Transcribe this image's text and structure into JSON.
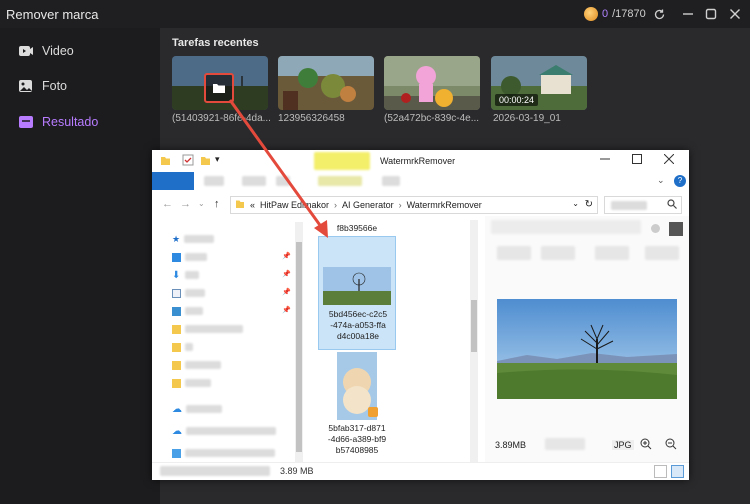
{
  "app": {
    "title": "Remover marca"
  },
  "credits": {
    "used": "0",
    "total": "/17870"
  },
  "window_controls": [
    "refresh",
    "minimize",
    "maximize",
    "close"
  ],
  "sidebar": {
    "items": [
      {
        "label": "Video",
        "icon": "video-icon",
        "active": false
      },
      {
        "label": "Foto",
        "icon": "photo-icon",
        "active": false
      },
      {
        "label": "Resultado",
        "icon": "result-icon",
        "active": true
      }
    ]
  },
  "recent": {
    "title": "Tarefas recentes",
    "items": [
      {
        "caption": "(51403921-86fe-4da...",
        "duration": ""
      },
      {
        "caption": "123956326458",
        "duration": ""
      },
      {
        "caption": "(52a472bc-839c-4e...",
        "duration": ""
      },
      {
        "caption": "2026-03-19_01",
        "duration": "00:00:24"
      }
    ]
  },
  "explorer": {
    "title": "WatermrkRemover",
    "path": [
      "«",
      "HitPaw Edimakor",
      "AI Generator",
      "WatermrkRemover"
    ],
    "files": [
      {
        "name": "f8b39566e",
        "selected": false
      },
      {
        "name": "5bd456ec-c2c5-474a-a053-ffad4c00a18e",
        "lines": [
          "5bd456ec-c2c5",
          "-474a-a053-ffa",
          "d4c00a18e"
        ],
        "selected": true
      },
      {
        "name": "5bfab317-d871-4d66-a389-bf9b57408985",
        "lines": [
          "5bfab317-d871",
          "-4d66-a389-bf9",
          "b57408985"
        ],
        "selected": false
      }
    ],
    "preview": {
      "size": "3.89MB",
      "type": "JPG"
    },
    "status": {
      "size": "3.89 MB"
    }
  },
  "colors": {
    "accent": "#b77cff",
    "highlight": "#e44a3c",
    "selection": "#cce4f7"
  }
}
